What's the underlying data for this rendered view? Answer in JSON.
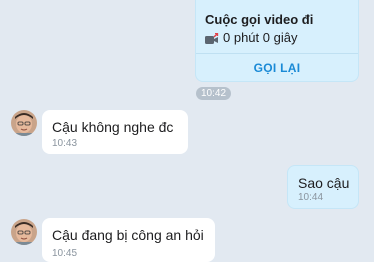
{
  "call": {
    "title": "Cuộc gọi video đi",
    "duration": "0 phút 0 giây",
    "action": "GỌI LẠI",
    "time": "10:42",
    "icon": "video-camera-outgoing-icon"
  },
  "messages": [
    {
      "direction": "in",
      "text": "Cậu không nghe đc",
      "time": "10:43"
    },
    {
      "direction": "out",
      "text": "Sao cậu",
      "time": "10:44"
    },
    {
      "direction": "in",
      "text": "Cậu đang bị công an hỏi",
      "time": "10:45"
    }
  ],
  "colors": {
    "background": "#e2e9f1",
    "sent_bubble": "#d7f0fd",
    "received_bubble": "#ffffff",
    "accent": "#1a8ad6",
    "missed_red": "#e0434b"
  }
}
